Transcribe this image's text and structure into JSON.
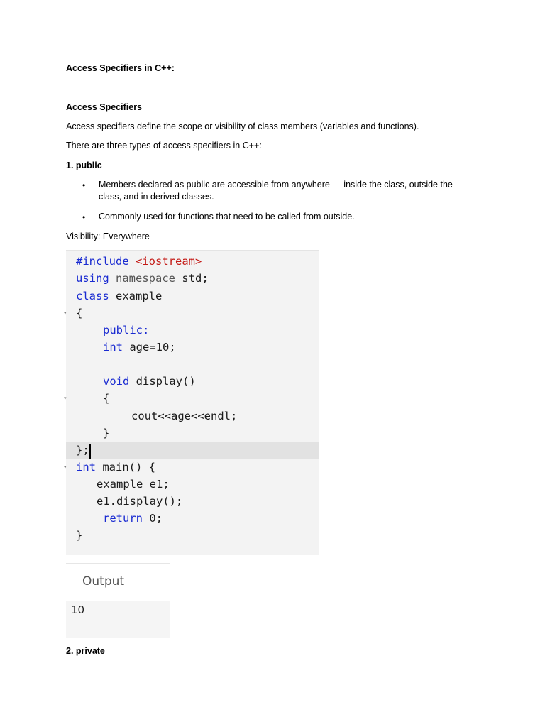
{
  "doc": {
    "title": "Access Specifiers in C++:",
    "section_heading": "Access Specifiers",
    "intro": "Access specifiers define the scope or visibility of class members (variables and functions).",
    "types_line": "There are three types of access specifiers in C++:",
    "public_heading": "1. public",
    "bullets": [
      "Members declared as public are accessible from anywhere — inside the class, outside the class, and in derived classes.",
      "Commonly used for functions that need to be called from outside."
    ],
    "bullet_symbol": "•",
    "visibility": "Visibility: Everywhere",
    "private_heading": "2. private"
  },
  "code": {
    "include_kw": "#include",
    "include_lib": "<iostream>",
    "using_kw": "using",
    "namespace_kw": "namespace",
    "std_text": "std;",
    "class_kw": "class",
    "class_name": "example",
    "open_brace": "{",
    "public_label": "public:",
    "int_kw": "int",
    "age_decl": "age=10;",
    "void_kw": "void",
    "display_decl": "display()",
    "inner_open": "{",
    "cout_line": "cout<<age<<endl;",
    "inner_close": "}",
    "class_close": "};",
    "main_int_kw": "int",
    "main_decl": "main() {",
    "obj_decl": "example e1;",
    "call_line": "e1.display();",
    "return_kw": "return",
    "return_val": "0;",
    "main_close": "}",
    "fold_symbol": "▾"
  },
  "output": {
    "title": "Output",
    "value": "10"
  }
}
